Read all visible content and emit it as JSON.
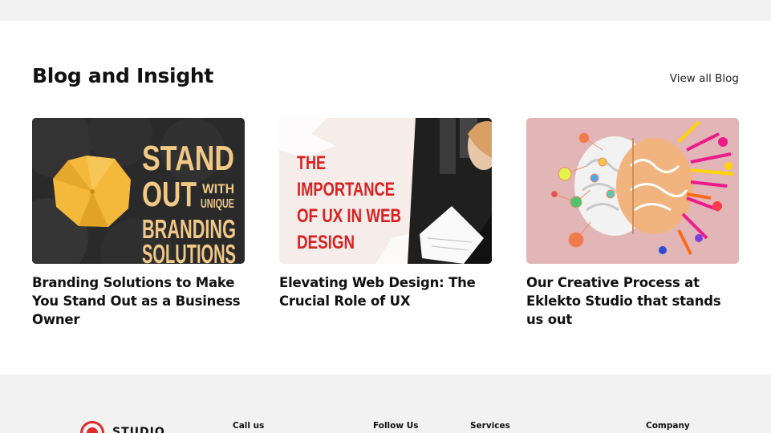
{
  "section": {
    "title": "Blog and Insight",
    "view_all": "View all Blog"
  },
  "posts": [
    {
      "title": "Branding Solutions to Make You Stand Out as a Business Owner",
      "image_text": [
        "STAND",
        "OUT",
        "WITH",
        "UNIQUE",
        "BRANDING",
        "SOLUTIONS"
      ]
    },
    {
      "title": "Elevating Web Design: The Crucial Role of UX",
      "image_text": [
        "THE",
        "IMPORTANCE",
        "OF UX IN WEB",
        "DESIGN"
      ]
    },
    {
      "title": "Our Creative Process at Eklekto Studio that stands us out",
      "image_text": []
    }
  ],
  "footer": {
    "logo_text": "STUDIO",
    "columns": [
      "Call us",
      "Follow Us",
      "Services",
      "Company"
    ]
  },
  "colors": {
    "accent_red": "#e02b2b",
    "band_gray": "#f2f2f2",
    "umbrella_yellow": "#f4b83a"
  }
}
